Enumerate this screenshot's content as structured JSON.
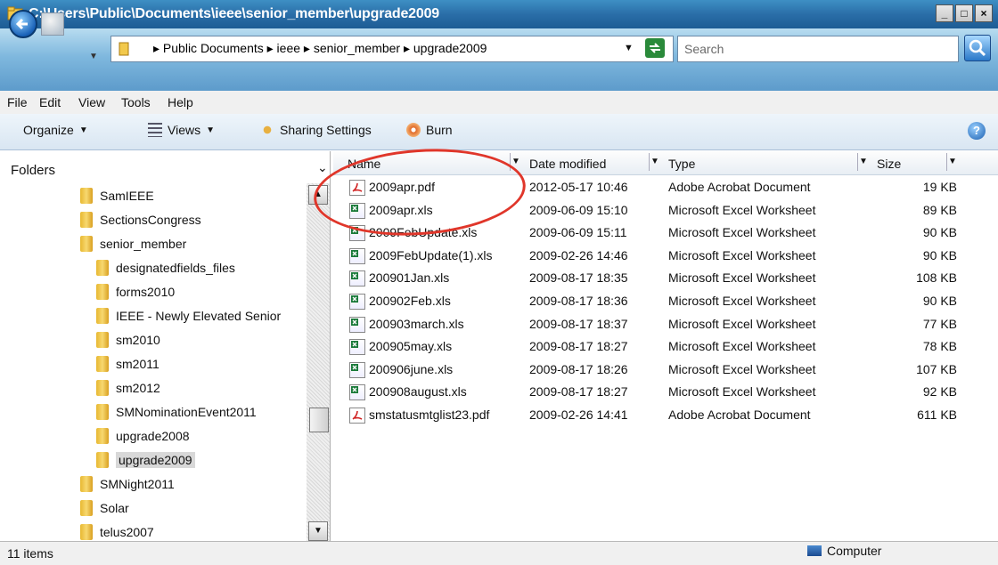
{
  "window": {
    "title": "C:\\Users\\Public\\Documents\\ieee\\senior_member\\upgrade2009"
  },
  "address": {
    "crumbs": "▸ Public Documents ▸ ieee ▸ senior_member ▸ upgrade2009",
    "search_placeholder": "Search"
  },
  "menu": [
    "File",
    "Edit",
    "View",
    "Tools",
    "Help"
  ],
  "toolbar": {
    "organize": "Organize",
    "views": "Views",
    "sharing": "Sharing Settings",
    "burn": "Burn"
  },
  "folders": {
    "header": "Folders",
    "items": [
      {
        "label": "SamIEEE",
        "depth": 1
      },
      {
        "label": "SectionsCongress",
        "depth": 1
      },
      {
        "label": "senior_member",
        "depth": 1
      },
      {
        "label": "designatedfields_files",
        "depth": 2
      },
      {
        "label": "forms2010",
        "depth": 2
      },
      {
        "label": "IEEE - Newly Elevated Senior",
        "depth": 2
      },
      {
        "label": "sm2010",
        "depth": 2
      },
      {
        "label": "sm2011",
        "depth": 2
      },
      {
        "label": "sm2012",
        "depth": 2
      },
      {
        "label": "SMNominationEvent2011",
        "depth": 2
      },
      {
        "label": "upgrade2008",
        "depth": 2
      },
      {
        "label": "upgrade2009",
        "depth": 2,
        "selected": true
      },
      {
        "label": "SMNight2011",
        "depth": 1
      },
      {
        "label": "Solar",
        "depth": 1
      },
      {
        "label": "telus2007",
        "depth": 1
      }
    ]
  },
  "columns": {
    "name": "Name",
    "date": "Date modified",
    "type": "Type",
    "size": "Size"
  },
  "files": [
    {
      "name": "2009apr.pdf",
      "date": "2012-05-17 10:46",
      "type": "Adobe Acrobat Document",
      "size": "19 KB",
      "icon": "pdf"
    },
    {
      "name": "2009apr.xls",
      "date": "2009-06-09 15:10",
      "type": "Microsoft Excel Worksheet",
      "size": "89 KB",
      "icon": "xls"
    },
    {
      "name": "2009FebUpdate.xls",
      "date": "2009-06-09 15:11",
      "type": "Microsoft Excel Worksheet",
      "size": "90 KB",
      "icon": "xls"
    },
    {
      "name": "2009FebUpdate(1).xls",
      "date": "2009-02-26 14:46",
      "type": "Microsoft Excel Worksheet",
      "size": "90 KB",
      "icon": "xls"
    },
    {
      "name": "200901Jan.xls",
      "date": "2009-08-17 18:35",
      "type": "Microsoft Excel Worksheet",
      "size": "108 KB",
      "icon": "xls"
    },
    {
      "name": "200902Feb.xls",
      "date": "2009-08-17 18:36",
      "type": "Microsoft Excel Worksheet",
      "size": "90 KB",
      "icon": "xls"
    },
    {
      "name": "200903march.xls",
      "date": "2009-08-17 18:37",
      "type": "Microsoft Excel Worksheet",
      "size": "77 KB",
      "icon": "xls"
    },
    {
      "name": "200905may.xls",
      "date": "2009-08-17 18:27",
      "type": "Microsoft Excel Worksheet",
      "size": "78 KB",
      "icon": "xls"
    },
    {
      "name": "200906june.xls",
      "date": "2009-08-17 18:26",
      "type": "Microsoft Excel Worksheet",
      "size": "107 KB",
      "icon": "xls"
    },
    {
      "name": "200908august.xls",
      "date": "2009-08-17 18:27",
      "type": "Microsoft Excel Worksheet",
      "size": "92 KB",
      "icon": "xls"
    },
    {
      "name": "smstatusmtglist23.pdf",
      "date": "2009-02-26 14:41",
      "type": "Adobe Acrobat Document",
      "size": "611 KB",
      "icon": "pdf"
    }
  ],
  "status": {
    "items": "11 items",
    "zone": "Computer"
  },
  "colors": {
    "accent": "#1d5c94",
    "annotation": "#e0362a"
  }
}
